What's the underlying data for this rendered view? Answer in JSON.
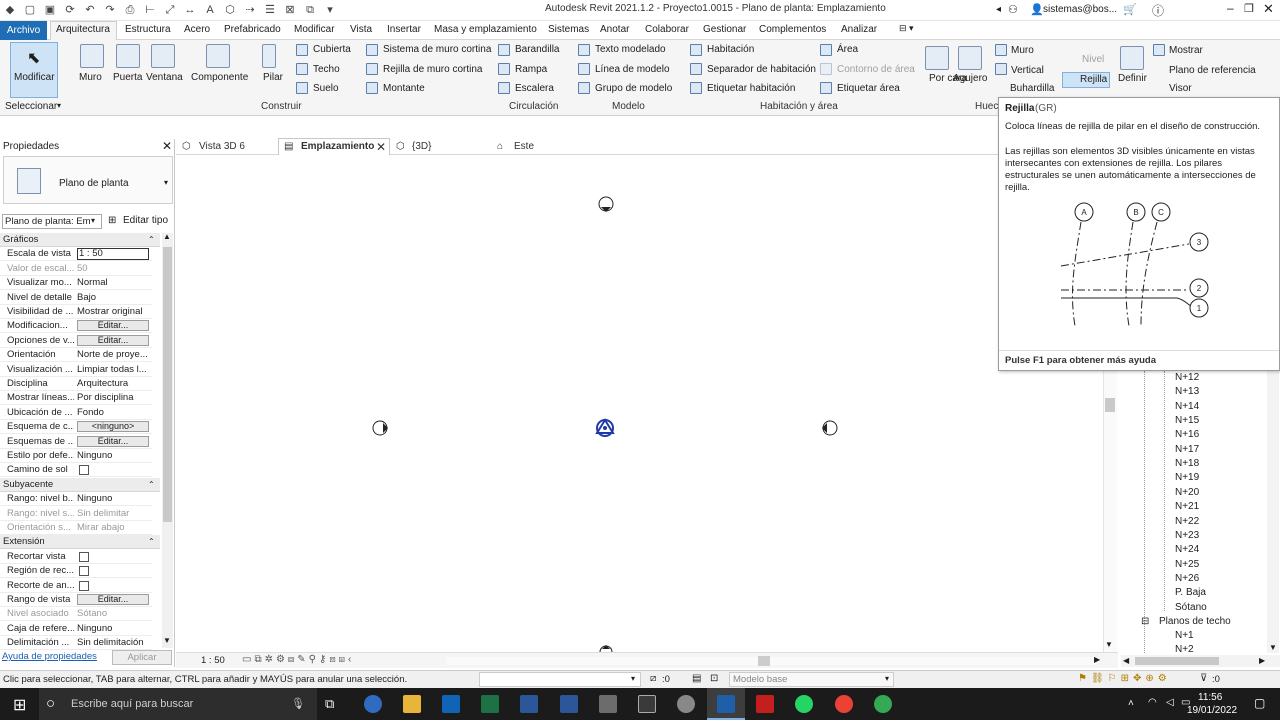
{
  "window": {
    "title": "Autodesk Revit 2021.1.2 - Proyecto1.0015 - Plano de planta: Emplazamiento",
    "user": "sistemas@bos..."
  },
  "menu_tabs": [
    "Archivo",
    "Arquitectura",
    "Estructura",
    "Acero",
    "Prefabricado",
    "Modificar",
    "Vista",
    "Insertar",
    "Masa y emplazamiento",
    "Sistemas",
    "Anotar",
    "Colaborar",
    "Gestionar",
    "Complementos",
    "Analizar"
  ],
  "ribbon": {
    "select": {
      "modificar": "Modificar",
      "seleccionar": "Seleccionar"
    },
    "build": {
      "muro": "Muro",
      "puerta": "Puerta",
      "ventana": "Ventana",
      "componente": "Componente",
      "pilar": "Pilar",
      "cubierta": "Cubierta",
      "techo": "Techo",
      "suelo": "Suelo",
      "sistema_muro_cortina": "Sistema de muro cortina",
      "rejilla_muro_cortina": "Rejilla de muro cortina",
      "montante": "Montante",
      "label": "Construir"
    },
    "circulation": {
      "barandilla": "Barandilla",
      "rampa": "Rampa",
      "escalera": "Escalera",
      "label": "Circulación"
    },
    "model": {
      "texto": "Texto modelado",
      "linea": "Línea de modelo",
      "grupo": "Grupo de modelo",
      "label": "Modelo"
    },
    "room": {
      "habitacion": "Habitación",
      "separador": "Separador de habitación",
      "etiquetar_hab": "Etiquetar habitación",
      "area": "Área",
      "contorno": "Contorno de área",
      "etiquetar_area": "Etiquetar área",
      "label": "Habitación y área"
    },
    "opening": {
      "por_cara": "Por cara",
      "agujero": "Agujero",
      "muro": "Muro",
      "vertical": "Vertical",
      "buhardilla": "Buhardilla",
      "label": "Huec"
    },
    "datum": {
      "nivel": "Nivel",
      "rejilla": "Rejilla",
      "definir": "Definir"
    },
    "workplane": {
      "mostrar": "Mostrar",
      "plano_ref": "Plano de referencia",
      "visor": "Visor"
    }
  },
  "properties": {
    "header": "Propiedades",
    "type": "Plano de planta",
    "instance_select": "Plano de planta: Em",
    "edit_type": "Editar tipo",
    "sections": [
      {
        "name": "Gráficos",
        "rows": [
          {
            "k": "Escala de vista",
            "v": "1 : 50"
          },
          {
            "k": "Valor de escal...",
            "v": "50",
            "dis": true
          },
          {
            "k": "Visualizar mo...",
            "v": "Normal"
          },
          {
            "k": "Nivel de detalle",
            "v": "Bajo"
          },
          {
            "k": "Visibilidad de ...",
            "v": "Mostrar original"
          },
          {
            "k": "Modificacion...",
            "v": "Editar...",
            "btn": true
          },
          {
            "k": "Opciones de v...",
            "v": "Editar...",
            "btn": true
          },
          {
            "k": "Orientación",
            "v": "Norte de proye..."
          },
          {
            "k": "Visualización ...",
            "v": "Limpiar todas l..."
          },
          {
            "k": "Disciplina",
            "v": "Arquitectura"
          },
          {
            "k": "Mostrar líneas...",
            "v": "Por disciplina"
          },
          {
            "k": "Ubicación de ...",
            "v": "Fondo"
          },
          {
            "k": "Esquema de c...",
            "v": "<ninguno>",
            "btn": true
          },
          {
            "k": "Esquemas de ...",
            "v": "Editar...",
            "btn": true
          },
          {
            "k": "Estilo por defe...",
            "v": "Ninguno"
          },
          {
            "k": "Camino de sol",
            "v": "",
            "chk": true
          }
        ]
      },
      {
        "name": "Subyacente",
        "rows": [
          {
            "k": "Rango: nivel b...",
            "v": "Ninguno"
          },
          {
            "k": "Rango: nivel s...",
            "v": "Sin delimitar",
            "dis": true
          },
          {
            "k": "Orientación s...",
            "v": "Mirar abajo",
            "dis": true
          }
        ]
      },
      {
        "name": "Extensión",
        "rows": [
          {
            "k": "Recortar vista",
            "v": "",
            "chk": true
          },
          {
            "k": "Región de rec...",
            "v": "",
            "chk": true
          },
          {
            "k": "Recorte de an...",
            "v": "",
            "chk": true
          },
          {
            "k": "Rango de vista",
            "v": "Editar...",
            "btn": true
          },
          {
            "k": "Nivel asociado",
            "v": "Sótano",
            "dis": true
          },
          {
            "k": "Caja de refere...",
            "v": "Ninguno"
          },
          {
            "k": "Delimitación ...",
            "v": "Sin delimitación"
          }
        ]
      }
    ],
    "help": "Ayuda de propiedades",
    "apply": "Aplicar"
  },
  "view_tabs": [
    {
      "label": "Vista 3D 6"
    },
    {
      "label": "Emplazamiento",
      "active": true
    },
    {
      "label": "{3D}"
    },
    {
      "label": "Este"
    }
  ],
  "view_scale": "1 : 50",
  "tooltip": {
    "title": "Rejilla",
    "shortcut": "(GR)",
    "line1": "Coloca líneas de rejilla de pilar en el diseño de construcción.",
    "line2": "Las rejillas son elementos 3D visibles únicamente en vistas intersecantes con extensiones de rejilla. Los pilares estructurales se unen automáticamente a intersecciones de rejilla.",
    "grid_labels": [
      "A",
      "B",
      "C",
      "1",
      "2",
      "3"
    ],
    "footer": "Pulse F1 para obtener más ayuda"
  },
  "browser": {
    "levels": [
      "N+12",
      "N+13",
      "N+14",
      "N+15",
      "N+16",
      "N+17",
      "N+18",
      "N+19",
      "N+20",
      "N+21",
      "N+22",
      "N+23",
      "N+24",
      "N+25",
      "N+26",
      "P. Baja",
      "Sótano"
    ],
    "ceiling_group": "Planos de techo",
    "ceiling_items": [
      "N+1",
      "N+2"
    ]
  },
  "status": {
    "message": "Clic para seleccionar, TAB para alternar, CTRL para añadir y MAYÚS para anular una selección.",
    "zero": ":0",
    "model": "Modelo base",
    "filter": ":0"
  },
  "taskbar": {
    "search": "Escribe aquí para buscar",
    "time": "11:56",
    "date": "19/01/2022"
  }
}
